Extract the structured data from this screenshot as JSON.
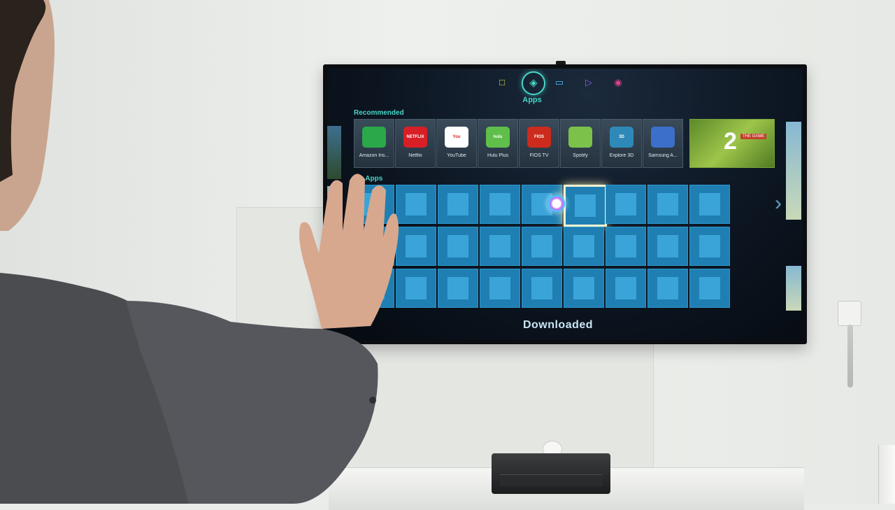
{
  "tv": {
    "nav": {
      "icons": [
        "speech-bubble-icon",
        "apps-icon",
        "tv-icon",
        "play-icon",
        "camera-icon"
      ],
      "active_label": "Apps",
      "colors": {
        "accent": "#46d6c7",
        "tile": "#1f7fb2",
        "tile_inner": "#3aa4d9"
      }
    },
    "recommended": {
      "label": "Recommended",
      "apps": [
        {
          "name": "Amazon Ins...",
          "icon_text": "",
          "color": "#2aa84a"
        },
        {
          "name": "Netflix",
          "icon_text": "NETFLIX",
          "color": "#d81f26"
        },
        {
          "name": "YouTube",
          "icon_text": "You",
          "color": "#ffffff"
        },
        {
          "name": "Hulu Plus",
          "icon_text": "hulu",
          "color": "#5fbf4a"
        },
        {
          "name": "FIOS TV",
          "icon_text": "FIOS",
          "color": "#cc2b1d"
        },
        {
          "name": "Spotify",
          "icon_text": "",
          "color": "#7cc14a"
        },
        {
          "name": "Explore 3D",
          "icon_text": "3D",
          "color": "#2f89b8"
        },
        {
          "name": "Samsung A...",
          "icon_text": "",
          "color": "#3b6fc9"
        }
      ],
      "promo": {
        "number": "2",
        "text": "THE GAME"
      }
    },
    "my_apps": {
      "label": "My Apps",
      "rows": 3,
      "cols": 9,
      "focused_index": 5
    },
    "footer": {
      "label": "Downloaded"
    }
  }
}
